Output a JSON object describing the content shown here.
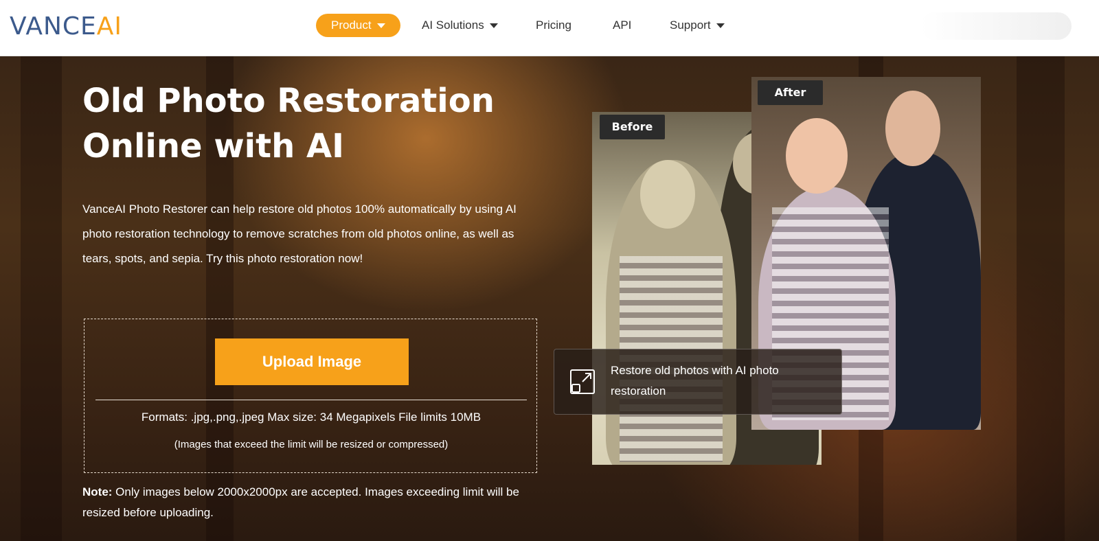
{
  "header": {
    "logo_main": "VANCE",
    "logo_accent": "AI",
    "nav": [
      {
        "label": "Product",
        "has_caret": true,
        "active": true
      },
      {
        "label": "AI Solutions",
        "has_caret": true,
        "active": false
      },
      {
        "label": "Pricing",
        "has_caret": false,
        "active": false
      },
      {
        "label": "API",
        "has_caret": false,
        "active": false
      },
      {
        "label": "Support",
        "has_caret": true,
        "active": false
      }
    ]
  },
  "hero": {
    "title_line1": "Old Photo Restoration",
    "title_line2": "Online with AI",
    "description": "VanceAI Photo Restorer can help restore old photos 100% automatically by using AI photo restoration technology to remove scratches from old photos online, as well as tears, spots, and sepia. Try this photo restoration now!",
    "upload_button": "Upload Image",
    "formats": "Formats: .jpg,.png,.jpeg Max size: 34 Megapixels File limits 10MB",
    "limit_note": "(Images that exceed the limit will be resized or compressed)",
    "note_label": "Note:",
    "note_text": " Only images below 2000x2000px are accepted. Images exceeding limit will be resized before uploading."
  },
  "comparison": {
    "before_label": "Before",
    "after_label": "After",
    "caption": "Restore old photos with AI photo restoration"
  },
  "colors": {
    "accent": "#f7a11a",
    "logo_blue": "#3c5a8c",
    "tag_bg": "#2b2b2b"
  },
  "icons": {
    "nav_caret": "chevron-down-icon",
    "caption": "expand-icon"
  }
}
